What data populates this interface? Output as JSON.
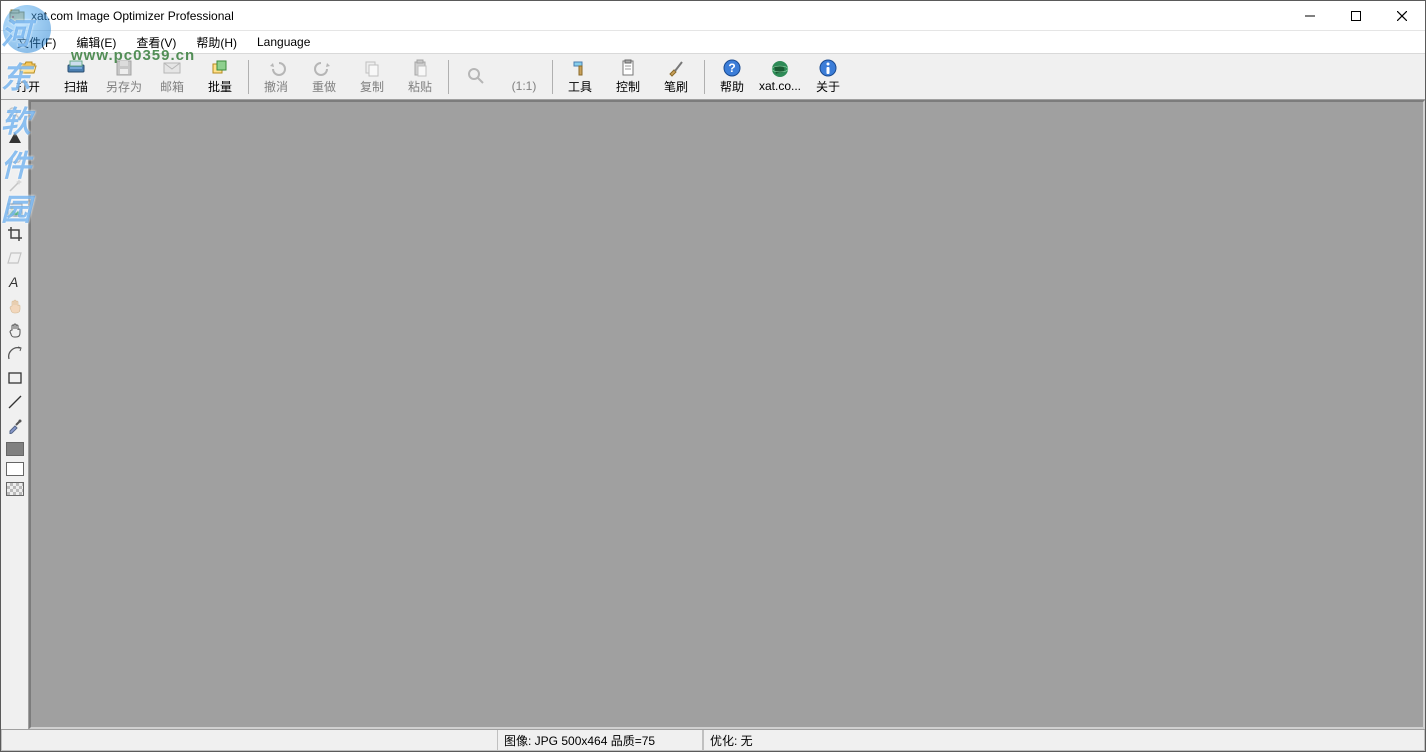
{
  "window": {
    "title": "xat.com   Image Optimizer Professional"
  },
  "menubar": {
    "items": [
      {
        "label": "文件(F)"
      },
      {
        "label": "编辑(E)"
      },
      {
        "label": "查看(V)"
      },
      {
        "label": "帮助(H)"
      },
      {
        "label": "Language"
      }
    ]
  },
  "toolbar": {
    "items": [
      {
        "name": "open-button",
        "label": "打开",
        "icon": "folder-open-icon",
        "enabled": true
      },
      {
        "name": "scan-button",
        "label": "扫描",
        "icon": "scanner-icon",
        "enabled": true
      },
      {
        "name": "save-as-button",
        "label": "另存为",
        "icon": "floppy-icon",
        "enabled": false
      },
      {
        "name": "mail-button",
        "label": "邮箱",
        "icon": "envelope-icon",
        "enabled": false
      },
      {
        "name": "batch-button",
        "label": "批量",
        "icon": "batch-icon",
        "enabled": true
      },
      {
        "sep": true
      },
      {
        "name": "undo-button",
        "label": "撤消",
        "icon": "undo-icon",
        "enabled": false
      },
      {
        "name": "redo-button",
        "label": "重做",
        "icon": "redo-icon",
        "enabled": false
      },
      {
        "name": "copy-button",
        "label": "复制",
        "icon": "copy-icon",
        "enabled": false
      },
      {
        "name": "paste-button",
        "label": "粘贴",
        "icon": "paste-icon",
        "enabled": false
      },
      {
        "sep": true
      },
      {
        "name": "zoom-button",
        "label": "",
        "icon": "zoom-icon",
        "enabled": false
      },
      {
        "name": "one-to-one-button",
        "label": "(1:1)",
        "icon": "",
        "enabled": false,
        "text_as_icon": true
      },
      {
        "sep": true
      },
      {
        "name": "tools-button",
        "label": "工具",
        "icon": "hammer-icon",
        "enabled": true
      },
      {
        "name": "control-button",
        "label": "控制",
        "icon": "clipboard-icon",
        "enabled": true
      },
      {
        "name": "brush-button",
        "label": "笔刷",
        "icon": "brush-icon",
        "enabled": true
      },
      {
        "sep": true
      },
      {
        "name": "help-button",
        "label": "帮助",
        "icon": "help-icon",
        "enabled": true
      },
      {
        "name": "xat-button",
        "label": "xat.co...",
        "icon": "globe-icon",
        "enabled": true
      },
      {
        "name": "about-button",
        "label": "关于",
        "icon": "info-icon",
        "enabled": true
      }
    ]
  },
  "sidebar": {
    "tools": [
      {
        "name": "zoom-tool",
        "icon": "magnifier-icon",
        "enabled": false
      },
      {
        "name": "fill-tool",
        "icon": "triangle-icon",
        "enabled": true
      },
      {
        "name": "curve-tool",
        "icon": "curve-icon",
        "enabled": false
      },
      {
        "name": "wand-tool",
        "icon": "wand-icon",
        "enabled": false
      },
      {
        "name": "image-tool",
        "icon": "picture-icon",
        "enabled": true
      },
      {
        "name": "crop-tool",
        "icon": "crop-icon",
        "enabled": true
      },
      {
        "name": "transform-tool",
        "icon": "skew-icon",
        "enabled": false
      },
      {
        "name": "text-tool",
        "icon": "text-icon",
        "enabled": true
      },
      {
        "name": "hand-tool",
        "icon": "hand-color-icon",
        "enabled": false
      },
      {
        "name": "grab-tool",
        "icon": "grab-icon",
        "enabled": true
      },
      {
        "name": "rotate-tool",
        "icon": "arc-icon",
        "enabled": true
      },
      {
        "name": "rect-tool",
        "icon": "rect-icon",
        "enabled": true
      },
      {
        "name": "line-tool",
        "icon": "line-icon",
        "enabled": true
      },
      {
        "name": "eyedropper-tool",
        "icon": "eyedropper-icon",
        "enabled": true
      }
    ],
    "color_swatches": [
      {
        "name": "swatch-gray",
        "color": "#808080"
      },
      {
        "name": "swatch-white",
        "color": "#ffffff"
      },
      {
        "name": "swatch-pattern",
        "color": "#c0c0c0"
      }
    ]
  },
  "statusbar": {
    "image_info": "图像: JPG 500x464  品质=75",
    "optimize_info": "优化: 无"
  },
  "watermark": {
    "text": "河东软件园",
    "url": "www.pc0359.cn"
  }
}
